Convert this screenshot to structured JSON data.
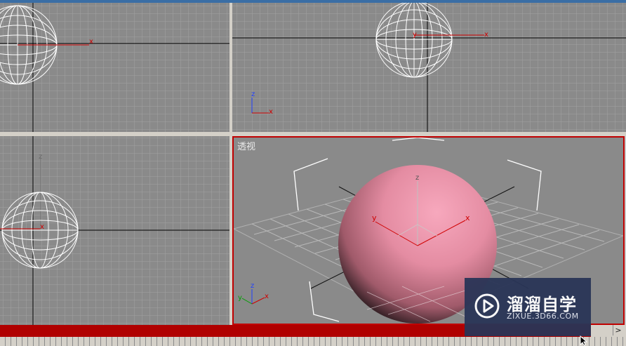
{
  "viewports": {
    "top_left": {
      "axis_x": "x"
    },
    "top_right": {
      "axis_x": "x",
      "axis_y": "y",
      "gizmo_z": "z",
      "gizmo_x": "x"
    },
    "bottom_left": {
      "axis_z": "z",
      "axis_x": "x"
    },
    "perspective": {
      "label": "透视",
      "axis_z": "z",
      "axis_x": "x",
      "axis_y": "y",
      "gizmo_z": "z",
      "gizmo_y": "y",
      "gizmo_x": "x"
    }
  },
  "timeline": {
    "next_label": ">"
  },
  "watermark": {
    "title": "溜溜自学",
    "subtitle": "ZIXUE.3D66.COM"
  },
  "colors": {
    "viewport_bg": "#8a8a8a",
    "grid": "#a0a0a0",
    "active_border": "#c00000",
    "sphere": "#e88aa0",
    "timebar": "#b00000"
  }
}
